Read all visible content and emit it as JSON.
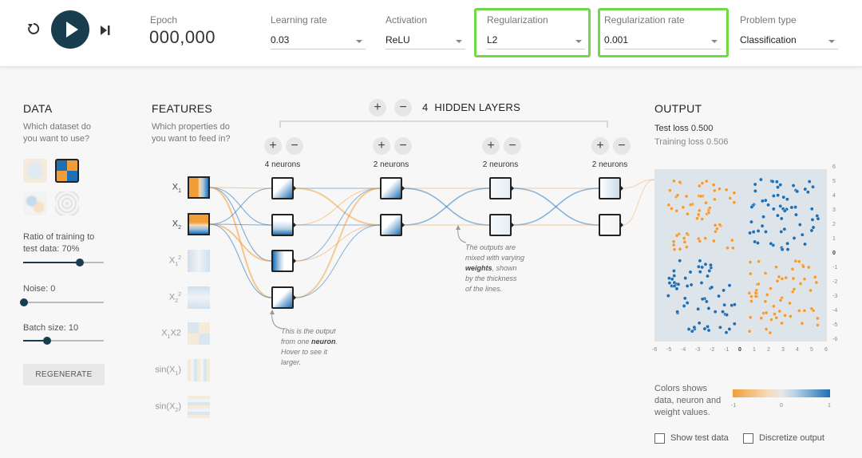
{
  "toolbar": {
    "reset_icon": "reset-icon",
    "play_icon": "play-icon",
    "step_icon": "step-icon",
    "epoch_label": "Epoch",
    "epoch_value": "000,000",
    "learning_rate": {
      "label": "Learning rate",
      "value": "0.03"
    },
    "activation": {
      "label": "Activation",
      "value": "ReLU"
    },
    "regularization": {
      "label": "Regularization",
      "value": "L2"
    },
    "regularization_rate": {
      "label": "Regularization rate",
      "value": "0.001"
    },
    "problem_type": {
      "label": "Problem type",
      "value": "Classification"
    },
    "highlight_color": "#72d84a"
  },
  "data_panel": {
    "title": "DATA",
    "question": "Which dataset do you want to use?",
    "datasets": [
      "circle",
      "xor",
      "gaussian",
      "spiral"
    ],
    "selected_dataset": "xor",
    "ratio_label": "Ratio of training to test data:",
    "ratio_value": "70%",
    "ratio_fraction": 0.7,
    "noise_label": "Noise:",
    "noise_value": "0",
    "noise_fraction": 0,
    "batch_label": "Batch size:",
    "batch_value": "10",
    "batch_fraction": 0.3,
    "regenerate": "REGENERATE"
  },
  "features_panel": {
    "title": "FEATURES",
    "question": "Which properties do you want to feed in?",
    "features": [
      {
        "main": "X",
        "sub": "1",
        "sup": "",
        "tail": "",
        "active": true
      },
      {
        "main": "X",
        "sub": "2",
        "sup": "",
        "tail": "",
        "active": true
      },
      {
        "main": "X",
        "sub": "1",
        "sup": "2",
        "tail": "",
        "active": false
      },
      {
        "main": "X",
        "sub": "2",
        "sup": "2",
        "tail": "",
        "active": false
      },
      {
        "main": "X",
        "sub": "1",
        "sup": "",
        "tail": "X2",
        "active": false
      },
      {
        "main": "sin(X",
        "sub": "1",
        "sup": "",
        "tail": ")",
        "active": false
      },
      {
        "main": "sin(X",
        "sub": "2",
        "sup": "",
        "tail": ")",
        "active": false
      }
    ]
  },
  "network": {
    "hidden_layers_count": "4",
    "hidden_layers_label": "HIDDEN LAYERS",
    "layers": [
      {
        "neurons_label": "4 neurons",
        "count": 4
      },
      {
        "neurons_label": "2 neurons",
        "count": 2
      },
      {
        "neurons_label": "2 neurons",
        "count": 2
      },
      {
        "neurons_label": "2 neurons",
        "count": 2
      }
    ],
    "annotation_neuron": [
      "This is the output",
      "from one ",
      "neuron",
      ". Hover to see it",
      "larger."
    ],
    "annotation_weights": [
      "The outputs are",
      "mixed with varying",
      "weights",
      ", shown",
      "by the thickness",
      "of the lines."
    ]
  },
  "output_panel": {
    "title": "OUTPUT",
    "test_loss": "Test loss 0.500",
    "training_loss": "Training loss 0.506",
    "x_ticks": [
      "-6",
      "-5",
      "-4",
      "-3",
      "-2",
      "-1",
      "0",
      "1",
      "2",
      "3",
      "4",
      "5",
      "6"
    ],
    "y_ticks": [
      "6",
      "5",
      "4",
      "3",
      "2",
      "1",
      "0",
      "-1",
      "-2",
      "-3",
      "-4",
      "-5",
      "-6"
    ],
    "legend_text": "Colors shows data, neuron and weight values.",
    "legend_min": "-1",
    "legend_mid": "0",
    "legend_max": "1",
    "show_test_data": "Show test data",
    "discretize_output": "Discretize output",
    "orange": "#f19e3a",
    "blue": "#1f6fb5"
  }
}
